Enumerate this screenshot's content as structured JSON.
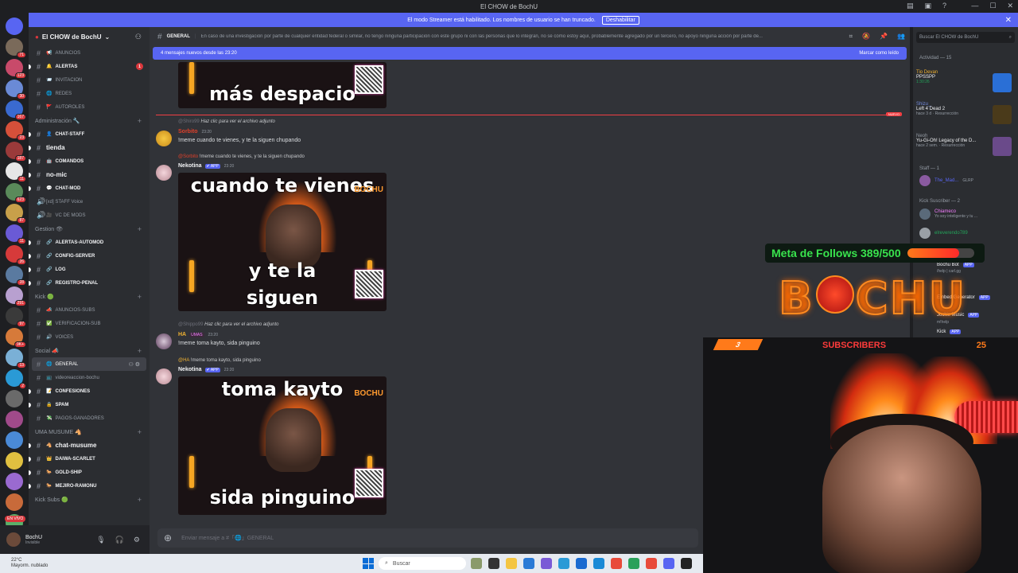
{
  "window": {
    "title": "El CHOW de BochU"
  },
  "streamer_bar": {
    "message": "El modo Streamer está habilitado. Los nombres de usuario se han truncado.",
    "button": "Deshabilitar"
  },
  "guild_badges": [
    "71",
    "123",
    "30",
    "167",
    "23",
    "187",
    "11",
    "623",
    "87",
    "11",
    "26",
    "28",
    "291",
    "97",
    "9K+",
    "13",
    "2"
  ],
  "live_badge": "EN VIVO",
  "server": {
    "name": "El CHOW de BochU"
  },
  "channels": [
    {
      "type": "channel",
      "emoji": "📢",
      "name": "ANUNCIOS",
      "style": "dim"
    },
    {
      "type": "channel",
      "emoji": "🔔",
      "name": "ALERTAS",
      "style": "bright",
      "unread": true,
      "mentions": "1"
    },
    {
      "type": "channel",
      "emoji": "📨",
      "name": "INVITACION",
      "style": "dim"
    },
    {
      "type": "channel",
      "emoji": "🌐",
      "name": "REDES",
      "style": "dim"
    },
    {
      "type": "channel",
      "emoji": "🚩",
      "name": "AUTOROLES",
      "style": "dim"
    },
    {
      "type": "category",
      "name": "Administración 🔧"
    },
    {
      "type": "channel",
      "emoji": "👤",
      "name": "CHAT-STAFF",
      "style": "bright",
      "unread": true
    },
    {
      "type": "channel",
      "emoji": "",
      "name": "tienda",
      "style": "bright big",
      "unread": true
    },
    {
      "type": "channel",
      "emoji": "🤖",
      "name": "COMANDOS",
      "style": "bright",
      "unread": true
    },
    {
      "type": "channel",
      "emoji": "",
      "name": "no-mic",
      "style": "bright big",
      "unread": true
    },
    {
      "type": "channel",
      "emoji": "💬",
      "name": "CHAT-MOD",
      "style": "bright",
      "unread": true
    },
    {
      "type": "voice",
      "emoji": "",
      "name": "[xd] STAFF Voice",
      "style": "dim"
    },
    {
      "type": "voice",
      "emoji": "🎥",
      "name": "VC DE MODS",
      "style": "dim"
    },
    {
      "type": "category",
      "name": "Gestion 👁"
    },
    {
      "type": "channel",
      "emoji": "🔗",
      "name": "ALERTAS-AUTOMOD",
      "style": "bright",
      "unread": true
    },
    {
      "type": "channel",
      "emoji": "🔗",
      "name": "CONFIG-SERVER",
      "style": "bright",
      "unread": true
    },
    {
      "type": "channel",
      "emoji": "🔗",
      "name": "LOG",
      "style": "bright",
      "unread": true
    },
    {
      "type": "channel",
      "emoji": "🔗",
      "name": "REGISTRO-PENAL",
      "style": "bright",
      "unread": true
    },
    {
      "type": "category",
      "name": "Kick 🟢"
    },
    {
      "type": "channel",
      "emoji": "📣",
      "name": "ANUNCIOS-SUBS",
      "style": "dim"
    },
    {
      "type": "channel",
      "emoji": "✅",
      "name": "VERIFICACION-SUB",
      "style": "dim"
    },
    {
      "type": "channel",
      "emoji": "🔊",
      "name": "VOICES",
      "style": "dim"
    },
    {
      "type": "category",
      "name": "Social 📣"
    },
    {
      "type": "channel",
      "emoji": "🌐",
      "name": "GENERAL",
      "style": "selected"
    },
    {
      "type": "channel",
      "emoji": "📺",
      "name": "videoreaccion-bochu",
      "style": "dim"
    },
    {
      "type": "channel",
      "emoji": "📝",
      "name": "CONFESIONES",
      "style": "bright",
      "unread": true
    },
    {
      "type": "channel",
      "emoji": "🔒",
      "name": "SPAM",
      "style": "bright",
      "unread": true
    },
    {
      "type": "channel",
      "emoji": "💸",
      "name": "PAGOS-GANADORES",
      "style": "dim"
    },
    {
      "type": "category",
      "name": "UMA MUSUME 🐴"
    },
    {
      "type": "channel",
      "emoji": "🐴",
      "name": "chat-musume",
      "style": "bright big",
      "unread": true
    },
    {
      "type": "channel",
      "emoji": "👑",
      "name": "DAIWA-SCARLET",
      "style": "bright",
      "unread": true
    },
    {
      "type": "channel",
      "emoji": "🐎",
      "name": "GOLD-SHIP",
      "style": "bright",
      "unread": true
    },
    {
      "type": "channel",
      "emoji": "🐎",
      "name": "MEJIRO-RAMONU",
      "style": "bright",
      "unread": true
    },
    {
      "type": "category",
      "name": "Kick Subs 🟢"
    }
  ],
  "user": {
    "name": "BochU",
    "status": "Invisible"
  },
  "channel_header": {
    "name": "GENERAL",
    "topic": "En caso de una investigación por parte de cualquier entidad federal o similar, no tengo ninguna participación con este grupo ni con las personas que lo integran, no sé cómo estoy aquí, probablemente agregado por un tercero, no apoyo ninguna acción por parte de...",
    "search_placeholder": "Buscar El CHOW de BochU"
  },
  "new_messages_bar": {
    "text": "4 mensajes nuevos desde las 23:20",
    "action": "Marcar como leído"
  },
  "new_divider": "NUEVO",
  "messages": [
    {
      "reply_user": "@Shiro99",
      "reply_text": "Haz clic para ver el archivo adjunto",
      "user": "Sorbito",
      "time": "23:20",
      "text": "!meme cuando te vienes, y te la siguen chupando"
    },
    {
      "reply_user": "@Sorbito",
      "reply_text": "!meme cuando te vienes, y te la siguen chupando",
      "user": "Nekotina",
      "tag": "✔ APP",
      "time": "23:20",
      "text": ""
    },
    {
      "reply_user": "@Shippo99",
      "reply_text": "Haz clic para ver el archivo adjunto",
      "user": "HA",
      "tag": "UMAS",
      "time": "23:20",
      "text": "!meme toma kayto, sida pinguino"
    },
    {
      "reply_user": "@HA",
      "reply_text": "!meme toma kayto, sida pinguino",
      "user": "Nekotina",
      "tag": "✔ APP",
      "time": "23:20",
      "text": ""
    }
  ],
  "memes": [
    {
      "top": "",
      "bottom": "más despacio"
    },
    {
      "top": "cuando te vienes",
      "bottom": "y te la siguen chupando"
    },
    {
      "top": "toma kayto",
      "bottom": "sida pinguino"
    }
  ],
  "meme_logo": "BOCHU",
  "composer": {
    "placeholder": "Enviar mensaje a #「🌐」GENERAL"
  },
  "members": {
    "activity_title": "Actividad — 15",
    "activities": [
      {
        "user": "Tio Devan",
        "title": "PPSSPP",
        "detail": "1:30:26"
      },
      {
        "user": "Shizu_",
        "title": "Left 4 Dead 2",
        "detail": "hace 3 d · Resurrección"
      },
      {
        "user": "Neoh",
        "title": "Yu-Gi-Oh! Legacy of the D...",
        "detail": "hace 2 sem. · Resurrección"
      }
    ],
    "staff_title": "Staff — 1",
    "staff": [
      {
        "name": "The_Mad...",
        "tag": "GLRP"
      }
    ],
    "kick_title": "Kick Suscriber — 2",
    "kick": [
      {
        "name": "Chiameco",
        "sub": "Yo soy inteligente y tu ..."
      },
      {
        "name": "elreverendo789",
        "sub": ""
      }
    ],
    "more": [
      {
        "name": "Bochu Bot",
        "sub": "/help | carl.gg",
        "tag": "APP"
      },
      {
        "name": "Embed Generator",
        "sub": "",
        "tag": "APP"
      },
      {
        "name": "Jockie Music",
        "sub": "m!help",
        "tag": "APP"
      },
      {
        "name": "Kick",
        "sub": "",
        "tag": "APP"
      }
    ]
  },
  "overlay": {
    "follows_text": "Meta de Follows 389/500",
    "follows_progress": 0.778,
    "logo": "BOCHU",
    "subs_left": "3",
    "subs_label": "SUBSCRIBERS",
    "subs_right": "25"
  },
  "taskbar": {
    "temp": "22°C",
    "weather": "Mayorm. nublado",
    "search": "Buscar"
  },
  "colors": {
    "blurple": "#5865f2",
    "red": "#da373c",
    "online": "#23a55a",
    "follows_green": "#39e34d",
    "neon_orange": "#ff8a1f"
  }
}
